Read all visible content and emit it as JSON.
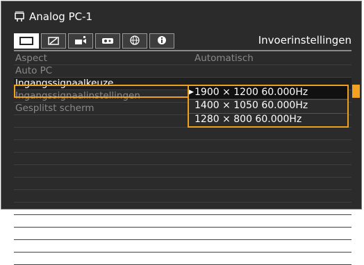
{
  "header": {
    "title": "Analog PC-1",
    "input_icon": "input-connector-icon"
  },
  "tabs": [
    {
      "icon": "screen-icon",
      "active": true
    },
    {
      "icon": "picture-adjust-icon",
      "active": false
    },
    {
      "icon": "installation-icon",
      "active": false
    },
    {
      "icon": "system-icon",
      "active": false
    },
    {
      "icon": "network-icon",
      "active": false
    },
    {
      "icon": "info-icon",
      "active": false
    }
  ],
  "menu_title": "Invoerinstellingen",
  "rows": [
    {
      "label": "Aspect",
      "value": "Automatisch"
    },
    {
      "label": "Auto PC",
      "value": ""
    },
    {
      "label": "Ingangssignaalkeuze",
      "value": ""
    },
    {
      "label": "Ingangssignaalinstellingen",
      "value": ""
    },
    {
      "label": "Gesplitst scherm",
      "value": ""
    }
  ],
  "dropdown": {
    "options": [
      "1900 × 1200 60.000Hz",
      "1400 × 1050 60.000Hz",
      "1280 × 800 60.000Hz"
    ],
    "selected": "1900 × 1200 60.000Hz"
  },
  "colors": {
    "accent": "#f0a020",
    "background": "#2b2b2b",
    "text": "#ffffff",
    "dim_text": "#8a8a8a"
  }
}
